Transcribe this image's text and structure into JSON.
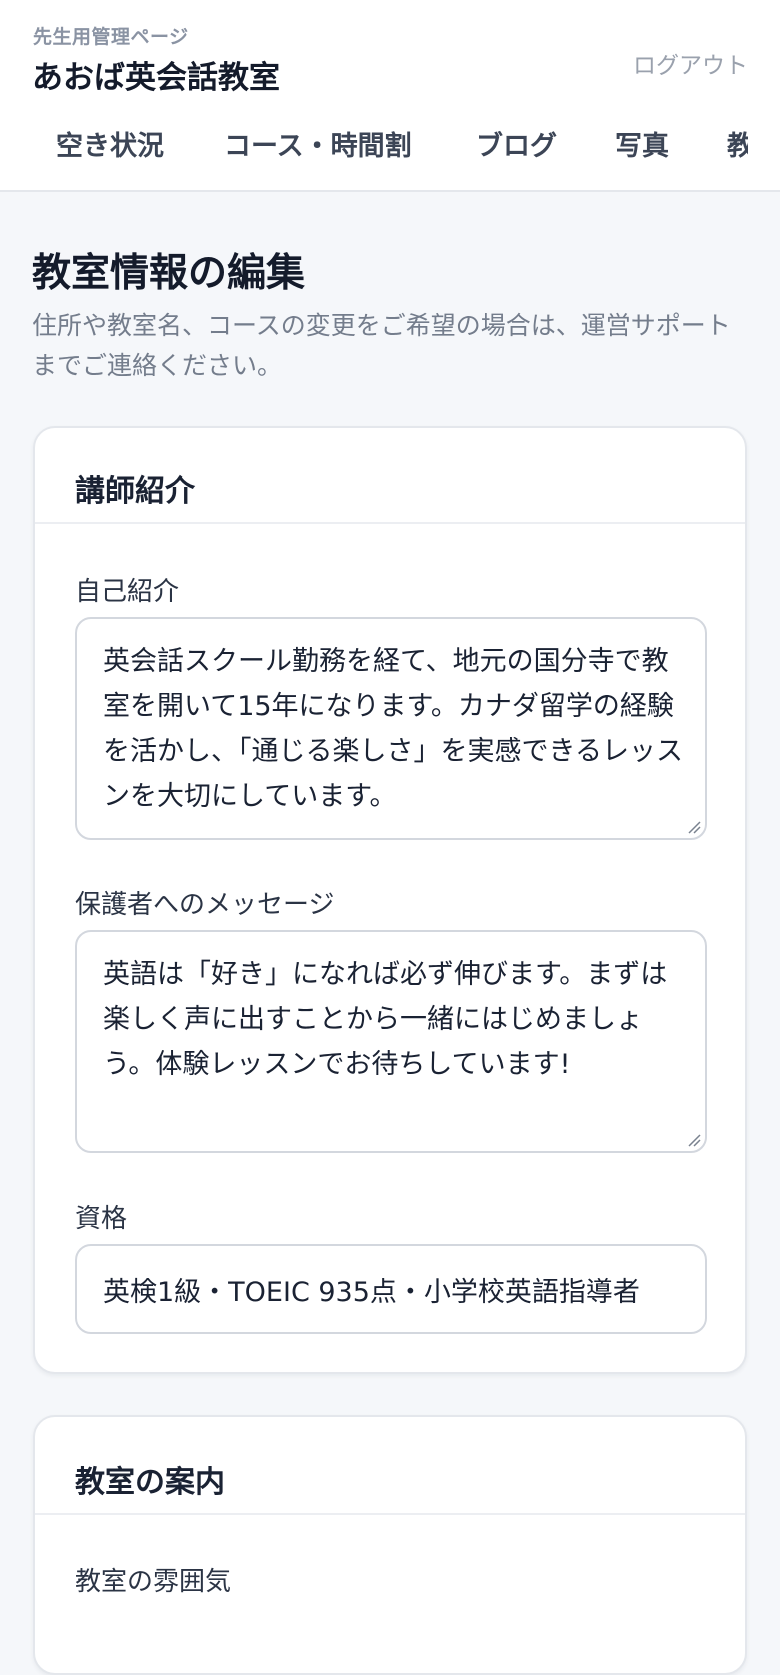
{
  "header": {
    "subtitle": "先生用管理ページ",
    "title": "あおば英会話教室",
    "logout_label": "ログアウト"
  },
  "nav": {
    "items": [
      {
        "label": "空き状況"
      },
      {
        "label": "コース・時間割"
      },
      {
        "label": "ブログ"
      },
      {
        "label": "写真"
      },
      {
        "label": "教"
      }
    ]
  },
  "page": {
    "title": "教室情報の編集",
    "description": "住所や教室名、コースの変更をご希望の場合は、運営サポートまでご連絡ください。"
  },
  "instructor_card": {
    "title": "講師紹介",
    "self_intro": {
      "label": "自己紹介",
      "value": "英会話スクール勤務を経て、地元の国分寺で教室を開いて15年になります。カナダ留学の経験を活かし、「通じる楽しさ」を実感できるレッスンを大切にしています。"
    },
    "parent_message": {
      "label": "保護者へのメッセージ",
      "value": "英語は「好き」になれば必ず伸びます。まずは楽しく声に出すことから一緒にはじめましょう。体験レッスンでお待ちしています!"
    },
    "qualifications": {
      "label": "資格",
      "value": "英検1級・TOEIC 935点・小学校英語指導者"
    }
  },
  "classroom_card": {
    "title": "教室の案内",
    "atmosphere": {
      "label": "教室の雰囲気"
    }
  }
}
